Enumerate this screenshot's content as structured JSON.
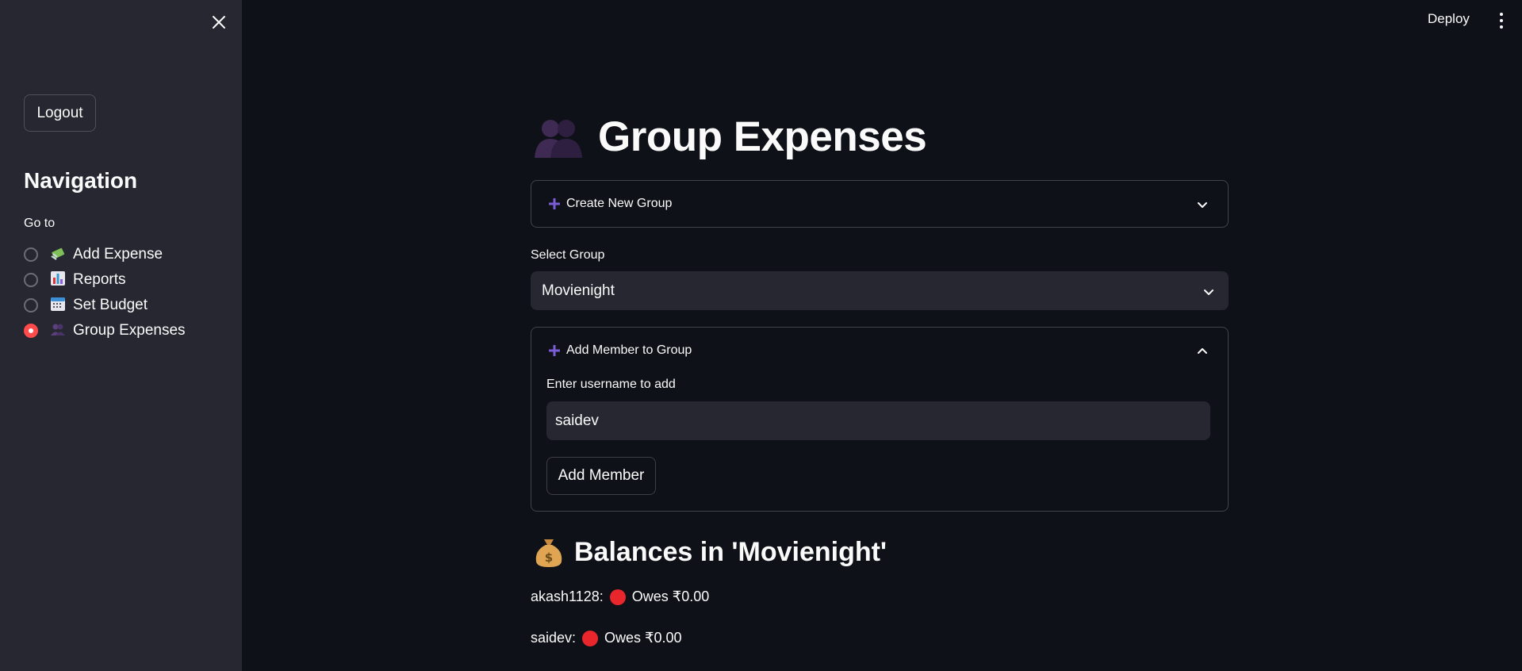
{
  "header": {
    "deploy_label": "Deploy",
    "menu_icon": "kebab-menu-icon"
  },
  "sidebar": {
    "close_icon": "close-icon",
    "logout_label": "Logout",
    "nav_title": "Navigation",
    "goto_label": "Go to",
    "items": [
      {
        "icon": "money-wings-icon",
        "label": "Add Expense",
        "checked": false
      },
      {
        "icon": "bar-chart-icon",
        "label": "Reports",
        "checked": false
      },
      {
        "icon": "calendar-icon",
        "label": "Set Budget",
        "checked": false
      },
      {
        "icon": "group-icon",
        "label": "Group Expenses",
        "checked": true
      }
    ]
  },
  "main": {
    "title_icon": "busts-in-silhouette-icon",
    "title": "Group Expenses",
    "create_group_label": "Create New Group",
    "select_group_label": "Select Group",
    "selected_group": "Movienight",
    "add_member_expander_label": "Add Member to Group",
    "username_label": "Enter username to add",
    "username_value": "saidev",
    "add_member_button": "Add Member",
    "balances_icon": "money-bag-icon",
    "balances_title": "Balances in 'Movienight'",
    "balances": [
      {
        "user": "akash1128:",
        "status": "Owes ₹0.00"
      },
      {
        "user": "saidev:",
        "status": "Owes ₹0.00"
      }
    ]
  },
  "colors": {
    "background": "#0e1117",
    "sidebar": "#262730",
    "accent_radio": "#ff4b4b",
    "plus_icon": "#7c5cd6",
    "debt_dot": "#e8262b"
  }
}
